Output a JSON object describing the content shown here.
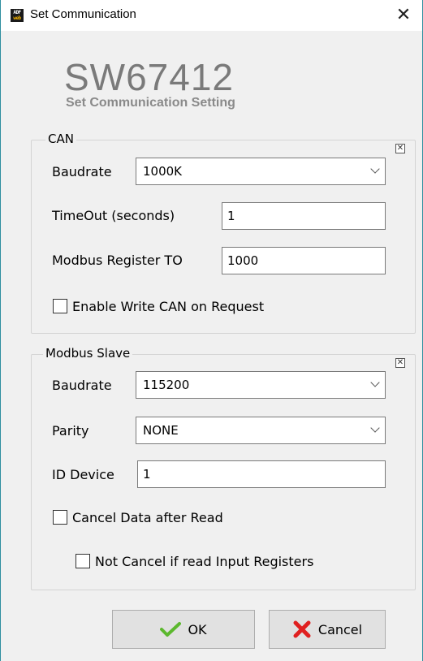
{
  "window": {
    "title": "Set Communication",
    "app_icon_line1": "ADF",
    "app_icon_line2": "web"
  },
  "brand": {
    "model": "SW67412",
    "subtitle": "Set Communication Setting"
  },
  "can": {
    "legend": "CAN",
    "baudrate_label": "Baudrate",
    "baudrate_value": "1000K",
    "timeout_label": "TimeOut (seconds)",
    "timeout_value": "1",
    "modbus_to_label": "Modbus Register TO",
    "modbus_to_value": "1000",
    "enable_write_label": "Enable Write CAN on Request",
    "enable_write_checked": false
  },
  "modbus": {
    "legend": "Modbus Slave",
    "baudrate_label": "Baudrate",
    "baudrate_value": "115200",
    "parity_label": "Parity",
    "parity_value": "NONE",
    "id_label": "ID Device",
    "id_value": "1",
    "cancel_data_label": "Cancel Data after Read",
    "cancel_data_checked": false,
    "not_cancel_label": "Not Cancel if read Input Registers",
    "not_cancel_checked": false
  },
  "buttons": {
    "ok": "OK",
    "cancel": "Cancel"
  },
  "icons": {
    "close": "close-icon",
    "ok": "checkmark-icon",
    "cancel": "red-x-icon"
  },
  "colors": {
    "ok_green": "#5cb82e",
    "cancel_red": "#e02020",
    "brand_gray": "#7a7a7a"
  }
}
